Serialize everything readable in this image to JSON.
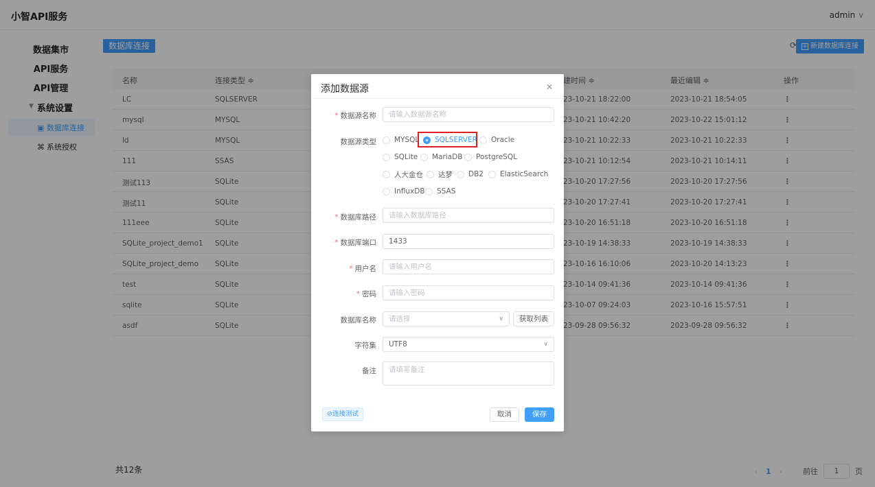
{
  "app": {
    "title": "小智API服务",
    "user": "admin"
  },
  "sidebar": {
    "items": [
      {
        "label": "数据集市"
      },
      {
        "label": "API服务"
      },
      {
        "label": "API管理"
      }
    ],
    "group": {
      "label": "系统设置",
      "caret_icon": "caret-down-icon"
    },
    "sub_items": [
      {
        "label": "数据库连接",
        "icon": "database-icon",
        "active": true
      },
      {
        "label": "系统授权",
        "icon": "license-icon",
        "active": false
      }
    ]
  },
  "main": {
    "tab": "数据库连接",
    "new_button": "新建数据库连接",
    "refresh_icon": "refresh-icon",
    "columns": [
      "名称",
      "连接类型 ≑",
      "建时间 ≑",
      "最近编辑 ≑",
      "操作"
    ],
    "rows": [
      {
        "name": "LC",
        "type": "SQLSERVER",
        "created": "23-10-21 18:22:00",
        "edited": "2023-10-21 18:54:05",
        "op": "⋮"
      },
      {
        "name": "mysql",
        "type": "MYSQL",
        "created": "23-10-21 10:42:20",
        "edited": "2023-10-22 15:01:12",
        "op": "⋮"
      },
      {
        "name": "ld",
        "type": "MYSQL",
        "created": "23-10-21 10:22:33",
        "edited": "2023-10-21 10:22:33",
        "op": "⋮"
      },
      {
        "name": "111",
        "type": "SSAS",
        "created": "23-10-21 10:12:54",
        "edited": "2023-10-21 10:14:11",
        "op": "⋮"
      },
      {
        "name": "测试113",
        "type": "SQLite",
        "created": "23-10-20 17:27:56",
        "edited": "2023-10-20 17:27:56",
        "op": "⋮"
      },
      {
        "name": "测试11",
        "type": "SQLite",
        "created": "23-10-20 17:27:41",
        "edited": "2023-10-20 17:27:41",
        "op": "⋮"
      },
      {
        "name": "111eee",
        "type": "SQLite",
        "created": "23-10-20 16:51:18",
        "edited": "2023-10-20 16:51:18",
        "op": "⋮"
      },
      {
        "name": "SQLite_project_demo1",
        "type": "SQLite",
        "created": "23-10-19 14:38:33",
        "edited": "2023-10-19 14:38:33",
        "op": "⋮"
      },
      {
        "name": "SQLite_project_demo",
        "type": "SQLite",
        "created": "23-10-16 16:10:06",
        "edited": "2023-10-20 14:13:23",
        "op": "⋮"
      },
      {
        "name": "test",
        "type": "SQLite",
        "created": "23-10-14 09:41:36",
        "edited": "2023-10-14 09:41:36",
        "op": "⋮"
      },
      {
        "name": "sqlite",
        "type": "SQLite",
        "created": "23-10-07 09:24:03",
        "edited": "2023-10-16 15:57:51",
        "op": "⋮"
      },
      {
        "name": "asdf",
        "type": "SQLite",
        "created": "23-09-28 09:56:32",
        "edited": "2023-09-28 09:56:32",
        "op": "⋮"
      }
    ],
    "total": "共12条",
    "pager": {
      "prev": "‹",
      "current": "1",
      "next": "›",
      "goto": "前往",
      "page_input": "1",
      "page_unit": "页"
    }
  },
  "dialog": {
    "title": "添加数据源",
    "close_icon": "close-icon",
    "fields": {
      "name": {
        "label": "数据源名称",
        "placeholder": "请输入数据源名称"
      },
      "type": {
        "label": "数据源类型"
      },
      "path": {
        "label": "数据库路径",
        "placeholder": "请输入数据库路径"
      },
      "port": {
        "label": "数据库端口",
        "value": "1433"
      },
      "user": {
        "label": "用户名",
        "placeholder": "请输入用户名"
      },
      "password": {
        "label": "密码",
        "placeholder": "请输入密码"
      },
      "dbname": {
        "label": "数据库名称",
        "placeholder": "请选择"
      },
      "charset": {
        "label": "字符集",
        "value": "UTF8"
      },
      "remark": {
        "label": "备注",
        "placeholder": "请填写备注"
      }
    },
    "db_types": [
      "MYSQL",
      "SQLSERVER",
      "Oracle",
      "SQLite",
      "MariaDB",
      "PostgreSQL",
      "人大金仓",
      "达梦",
      "DB2",
      "ElasticSearch",
      "InfluxDB",
      "SSAS"
    ],
    "selected_type": "SQLSERVER",
    "fetch_button": "获取列表",
    "test_button": "⊘连接测试",
    "cancel_button": "取消",
    "save_button": "保存",
    "highlight_color": "#e02020",
    "accent_color": "#409eff"
  }
}
